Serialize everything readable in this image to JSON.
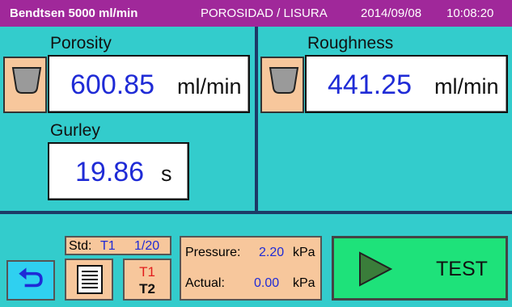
{
  "header": {
    "device": "Bendtsen   5000 ml/min",
    "mode": "POROSIDAD / LISURA",
    "date": "2014/09/08",
    "time": "10:08:20"
  },
  "porosity": {
    "label": "Porosity",
    "value": "600.85",
    "unit": "ml/min"
  },
  "roughness": {
    "label": "Roughness",
    "value": "441.25",
    "unit": "ml/min"
  },
  "gurley": {
    "label": "Gurley",
    "value": "19.86",
    "unit": "s"
  },
  "std": {
    "label": "Std:",
    "name": "T1",
    "index": "1/20"
  },
  "toggle": {
    "t1": "T1",
    "t2": "T2"
  },
  "pressure": {
    "label": "Pressure:",
    "value": "2.20",
    "unit": "kPa"
  },
  "actual": {
    "label": "Actual:",
    "value": "0.00",
    "unit": "kPa"
  },
  "test_button": {
    "label": "TEST"
  },
  "icons": {
    "back": "back-arrow-icon",
    "list": "list-icon",
    "cup": "cup-icon",
    "play": "play-icon"
  },
  "colors": {
    "title_bar": "#a0289a",
    "background": "#33cccc",
    "value_text": "#1f2bd6",
    "panel_tan": "#f7c79c",
    "test_green": "#1ee27a",
    "back_blue": "#2fd0f0",
    "t1_red": "#e21c1c"
  }
}
